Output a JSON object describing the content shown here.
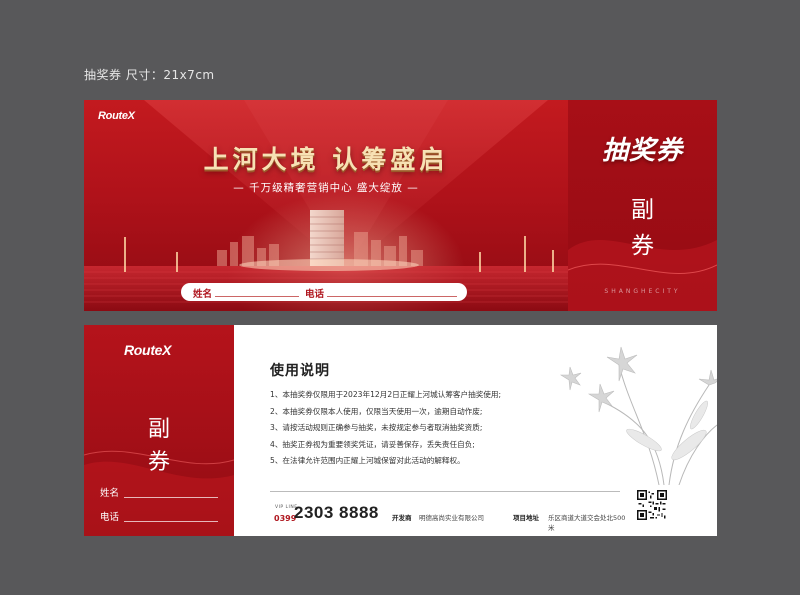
{
  "caption": "抽奖券  尺寸：21x7cm",
  "brand": "RouteX",
  "front": {
    "headline": "上河大境  认筹盛启",
    "subline": "— 千万级精奢营销中心 盛大绽放 —",
    "name_label": "姓名",
    "phone_label": "电话",
    "side_title": "抽奖券",
    "side_sub_1": "副",
    "side_sub_2": "券",
    "side_latin": "SHANGHECITY"
  },
  "back": {
    "stub_sub_1": "副",
    "stub_sub_2": "券",
    "name_label": "姓名",
    "phone_label": "电话",
    "instructions_title": "使用说明",
    "instructions": [
      "1、本抽奖券仅限用于2023年12月2日正耀上河城认筹客户抽奖使用;",
      "2、本抽奖券仅限本人使用，仅限当天使用一次，逾期自动作废;",
      "3、请按活动规则正确参与抽奖，未按规定参与者取消抽奖资质;",
      "4、抽奖正券视为重要领奖凭证，请妥善保存，丢失责任自负;",
      "5、在法律允许范围内正耀上河城保留对此活动的解释权。"
    ],
    "hotline_label": "VIP LINE",
    "area_code": "0399",
    "phone": "2303 8888",
    "developer_label": "开发商",
    "developer": "明德高尚实业有限公司",
    "address_label": "项目地址",
    "address": "乐区商道大道交会处北500米"
  },
  "colors": {
    "brand_red": "#b5131b",
    "gold": "#f7e1b4"
  }
}
